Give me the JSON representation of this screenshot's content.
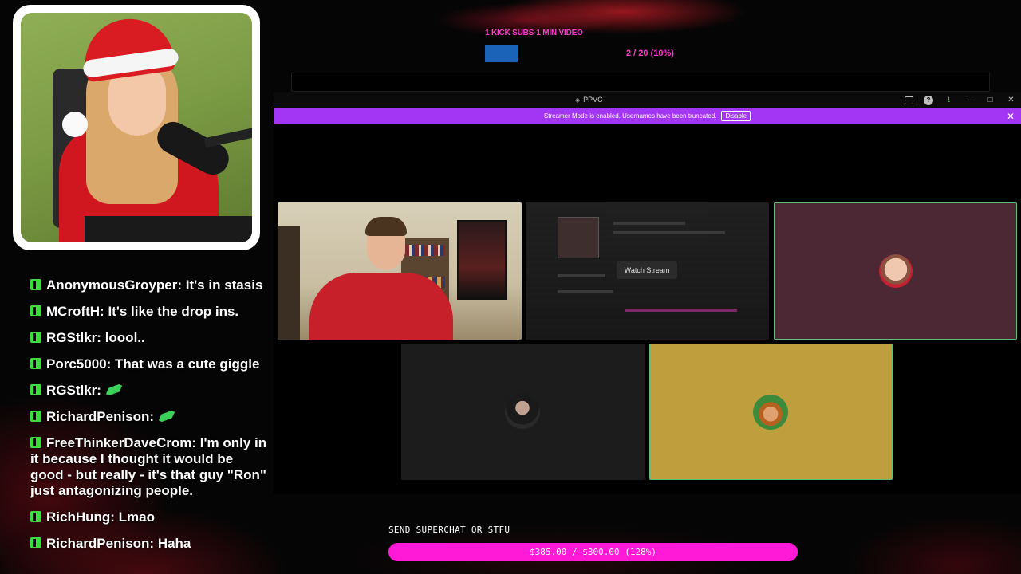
{
  "sub_goal": {
    "label": "1 KICK SUBS-1 MIN VIDEO",
    "count": "2 / 20 (10%)",
    "progress": 0.1
  },
  "app": {
    "title": "PPVC",
    "banner_text": "Streamer Mode is enabled. Usernames have been truncated.",
    "banner_button": "Disable",
    "watch_stream_label": "Watch Stream"
  },
  "chat": [
    {
      "user": "AnonymousGroyper",
      "text": " It's in stasis",
      "emote": false
    },
    {
      "user": "MCroftH",
      "text": " It's like the drop ins.",
      "emote": false
    },
    {
      "user": "RGStlkr",
      "text": " loool..",
      "emote": false
    },
    {
      "user": "Porc5000",
      "text": " That was a cute giggle",
      "emote": false
    },
    {
      "user": "RGStlkr",
      "text": " ",
      "emote": true
    },
    {
      "user": "RichardPenison",
      "text": " ",
      "emote": true
    },
    {
      "user": "FreeThinkerDaveCrom",
      "text": " I'm only in it because I thought it would be good - but really - it's that guy \"Ron\" just antagonizing people.",
      "emote": false
    },
    {
      "user": "RichHung",
      "text": " Lmao",
      "emote": false
    },
    {
      "user": "RichardPenison",
      "text": " Haha",
      "emote": false
    }
  ],
  "superchat": {
    "label": "SEND SUPERCHAT OR STFU",
    "amount": "$385.00 / $300.00 (128%)",
    "progress": 1.0
  },
  "colors": {
    "accent_pink": "#ff1ad8",
    "banner_purple": "#a335f5",
    "kick_green": "#3ddc3d",
    "speaking_border": "#5fbf7a"
  }
}
